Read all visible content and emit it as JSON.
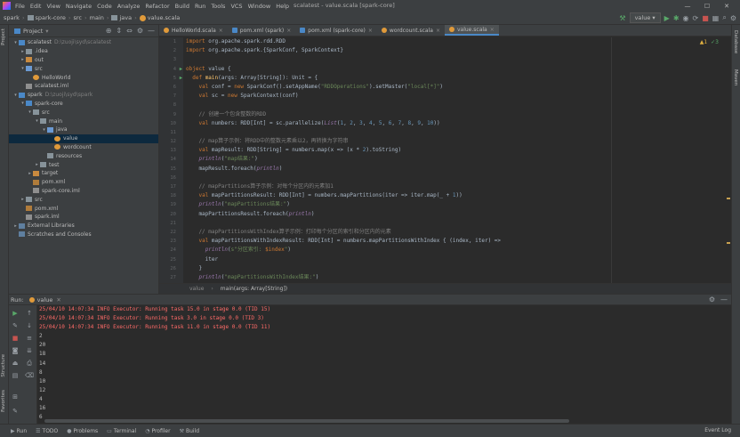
{
  "window": {
    "title": "scalatest - value.scala [spark-core]",
    "menu": [
      "File",
      "Edit",
      "View",
      "Navigate",
      "Code",
      "Analyze",
      "Refactor",
      "Build",
      "Run",
      "Tools",
      "VCS",
      "Window",
      "Help"
    ],
    "controls": [
      "—",
      "☐",
      "✕"
    ]
  },
  "breadcrumb": [
    "spark",
    "spark-core",
    "src",
    "main",
    "java",
    "value.scala"
  ],
  "run_config": "value",
  "left_strip": {
    "project": "Project",
    "structure": "Structure",
    "favorites": "Favorites"
  },
  "right_strip": {
    "database": "Database",
    "maven": "Maven"
  },
  "project": {
    "title": "Project",
    "tree": [
      {
        "label": "scalatest",
        "note": "D:\\zuoji\\syd\\scalatest",
        "arrow": "▾",
        "icon": "t-folder-blue",
        "indent": 0
      },
      {
        "label": ".idea",
        "note": "",
        "arrow": "▸",
        "icon": "t-folder",
        "indent": 1
      },
      {
        "label": "out",
        "note": "",
        "arrow": "▸",
        "icon": "t-folder-orange",
        "indent": 1
      },
      {
        "label": "src",
        "note": "",
        "arrow": "▾",
        "icon": "t-folder-src",
        "indent": 1
      },
      {
        "label": "HelloWorld",
        "note": "",
        "arrow": "",
        "icon": "t-file-scala",
        "indent": 2
      },
      {
        "label": "scalatest.iml",
        "note": "",
        "arrow": "",
        "icon": "t-file-iml",
        "indent": 1
      },
      {
        "label": "spark",
        "note": "D:\\zuoji\\syd\\spark",
        "arrow": "▾",
        "icon": "t-folder-blue",
        "indent": 0
      },
      {
        "label": "spark-core",
        "note": "",
        "arrow": "▾",
        "icon": "t-folder-blue",
        "indent": 1
      },
      {
        "label": "src",
        "note": "",
        "arrow": "▾",
        "icon": "t-folder",
        "indent": 2
      },
      {
        "label": "main",
        "note": "",
        "arrow": "▾",
        "icon": "t-folder",
        "indent": 3
      },
      {
        "label": "java",
        "note": "",
        "arrow": "▾",
        "icon": "t-folder-src",
        "indent": 4
      },
      {
        "label": "value",
        "note": "",
        "arrow": "",
        "icon": "t-file-scala",
        "indent": 5,
        "selected": true
      },
      {
        "label": "wordcount",
        "note": "",
        "arrow": "",
        "icon": "t-file-scala",
        "indent": 5
      },
      {
        "label": "resources",
        "note": "",
        "arrow": "",
        "icon": "t-folder",
        "indent": 4
      },
      {
        "label": "test",
        "note": "",
        "arrow": "▸",
        "icon": "t-folder",
        "indent": 3
      },
      {
        "label": "target",
        "note": "",
        "arrow": "▸",
        "icon": "t-folder-orange",
        "indent": 2
      },
      {
        "label": "pom.xml",
        "note": "",
        "arrow": "",
        "icon": "t-file-xml",
        "indent": 2
      },
      {
        "label": "spark-core.iml",
        "note": "",
        "arrow": "",
        "icon": "t-file-iml",
        "indent": 2
      },
      {
        "label": "src",
        "note": "",
        "arrow": "▸",
        "icon": "t-folder",
        "indent": 1
      },
      {
        "label": "pom.xml",
        "note": "",
        "arrow": "",
        "icon": "t-file-xml",
        "indent": 1
      },
      {
        "label": "spark.iml",
        "note": "",
        "arrow": "",
        "icon": "t-file-iml",
        "indent": 1
      },
      {
        "label": "External Libraries",
        "note": "",
        "arrow": "▸",
        "icon": "t-lib",
        "indent": 0
      },
      {
        "label": "Scratches and Consoles",
        "note": "",
        "arrow": "",
        "icon": "t-lib",
        "indent": 0
      }
    ]
  },
  "tabs": [
    {
      "label": "HelloWorld.scala",
      "kind": "scala",
      "active": false
    },
    {
      "label": "pom.xml (spark)",
      "kind": "maven",
      "active": false
    },
    {
      "label": "pom.xml (spark-core)",
      "kind": "maven",
      "active": false
    },
    {
      "label": "wordcount.scala",
      "kind": "scala",
      "active": false
    },
    {
      "label": "value.scala",
      "kind": "scala",
      "active": true
    }
  ],
  "inspections": {
    "warnings": "▲1",
    "weak": "✓3"
  },
  "code_lines": [
    [
      [
        "kw",
        "import "
      ],
      [
        "",
        "org.apache.spark.rdd.RDD"
      ]
    ],
    [
      [
        "kw",
        "import "
      ],
      [
        "",
        "org.apache.spark.{SparkConf, SparkContext}"
      ]
    ],
    [],
    [
      [
        "kw",
        "object "
      ],
      [
        "",
        "value {"
      ]
    ],
    [
      [
        "",
        "  "
      ],
      [
        "kw",
        "def "
      ],
      [
        "fn",
        "main"
      ],
      [
        "",
        "(args: Array["
      ],
      [
        "ty",
        "String"
      ],
      [
        "",
        "]): "
      ],
      [
        "ty",
        "Unit"
      ],
      [
        "",
        " = {"
      ]
    ],
    [
      [
        "",
        "    "
      ],
      [
        "kw",
        "val "
      ],
      [
        "",
        "conf = "
      ],
      [
        "kw",
        "new "
      ],
      [
        "",
        "SparkConf().setAppName("
      ],
      [
        "str",
        "\"RDDOperations\""
      ],
      [
        "",
        ").setMaster("
      ],
      [
        "str",
        "\"local[*]\""
      ],
      [
        "",
        ")"
      ]
    ],
    [
      [
        "",
        "    "
      ],
      [
        "kw",
        "val "
      ],
      [
        "",
        "sc = "
      ],
      [
        "kw",
        "new "
      ],
      [
        "",
        "SparkContext(conf)"
      ]
    ],
    [],
    [
      [
        "cmt",
        "    // 创建一个包含整数的RDD"
      ]
    ],
    [
      [
        "",
        "    "
      ],
      [
        "kw",
        "val "
      ],
      [
        "",
        "numbers: RDD["
      ],
      [
        "ty",
        "Int"
      ],
      [
        "",
        "] = sc.parallelize("
      ],
      [
        "it",
        "List"
      ],
      [
        "",
        "("
      ],
      [
        "num",
        "1"
      ],
      [
        "",
        ", "
      ],
      [
        "num",
        "2"
      ],
      [
        "",
        ", "
      ],
      [
        "num",
        "3"
      ],
      [
        "",
        ", "
      ],
      [
        "num",
        "4"
      ],
      [
        "",
        ", "
      ],
      [
        "num",
        "5"
      ],
      [
        "",
        ", "
      ],
      [
        "num",
        "6"
      ],
      [
        "",
        ", "
      ],
      [
        "num",
        "7"
      ],
      [
        "",
        ", "
      ],
      [
        "num",
        "8"
      ],
      [
        "",
        ", "
      ],
      [
        "num",
        "9"
      ],
      [
        "",
        ", "
      ],
      [
        "num",
        "10"
      ],
      [
        "",
        "))"
      ]
    ],
    [],
    [
      [
        "cmt",
        "    // map算子示例：将RDD中的整数元素乘以2，再转换为字符串"
      ]
    ],
    [
      [
        "",
        "    "
      ],
      [
        "kw",
        "val "
      ],
      [
        "",
        "mapResult: RDD["
      ],
      [
        "ty",
        "String"
      ],
      [
        "",
        "] = numbers.map(x => (x * "
      ],
      [
        "num",
        "2"
      ],
      [
        "",
        ").toString)"
      ]
    ],
    [
      [
        "",
        "    "
      ],
      [
        "it",
        "println"
      ],
      [
        "",
        "("
      ],
      [
        "str",
        "\"map结果:\""
      ],
      [
        "",
        ")"
      ]
    ],
    [
      [
        "",
        "    mapResult.foreach("
      ],
      [
        "it",
        "println"
      ],
      [
        "",
        ")"
      ]
    ],
    [],
    [
      [
        "cmt",
        "    // mapPartitions算子示例：对每个分区内的元素加1"
      ]
    ],
    [
      [
        "",
        "    "
      ],
      [
        "kw",
        "val "
      ],
      [
        "",
        "mapPartitionsResult: RDD["
      ],
      [
        "ty",
        "Int"
      ],
      [
        "",
        "] = numbers.mapPartitions(iter => iter.map(_ + "
      ],
      [
        "num",
        "1"
      ],
      [
        "",
        "))"
      ]
    ],
    [
      [
        "",
        "    "
      ],
      [
        "it",
        "println"
      ],
      [
        "",
        "("
      ],
      [
        "str",
        "\"mapPartitions结果:\""
      ],
      [
        "",
        ")"
      ]
    ],
    [
      [
        "",
        "    mapPartitionsResult.foreach("
      ],
      [
        "it",
        "println"
      ],
      [
        "",
        ")"
      ]
    ],
    [],
    [
      [
        "cmt",
        "    // mapPartitionsWithIndex算子示例：打印每个分区的索引和分区内的元素"
      ]
    ],
    [
      [
        "",
        "    "
      ],
      [
        "kw",
        "val "
      ],
      [
        "",
        "mapPartitionsWithIndexResult: RDD["
      ],
      [
        "ty",
        "Int"
      ],
      [
        "",
        "] = numbers.mapPartitionsWithIndex { (index, iter) =>"
      ]
    ],
    [
      [
        "",
        "      "
      ],
      [
        "it",
        "println"
      ],
      [
        "",
        "("
      ],
      [
        "str",
        "s\"分区索引: "
      ],
      [
        "kw",
        "$index"
      ],
      [
        "str",
        "\""
      ],
      [
        "",
        ")"
      ]
    ],
    [
      [
        "",
        "      iter"
      ]
    ],
    [
      [
        "",
        "    }"
      ]
    ],
    [
      [
        "",
        "    "
      ],
      [
        "it",
        "println"
      ],
      [
        "",
        "("
      ],
      [
        "str",
        "\"mapPartitionsWithIndex结果:\""
      ],
      [
        "",
        ")"
      ]
    ]
  ],
  "editor_status": {
    "object": "value",
    "method": "main(args: Array[String])"
  },
  "run": {
    "label": "Run:",
    "config": "value",
    "console": [
      {
        "text": "25/04/10 14:07:34 INFO Executor: Running task 15.0 in stage 0.0 (TID 15)",
        "err": true
      },
      {
        "text": "25/04/10 14:07:34 INFO Executor: Running task 3.0 in stage 0.0 (TID 3)",
        "err": true
      },
      {
        "text": "25/04/10 14:07:34 INFO Executor: Running task 11.0 in stage 0.0 (TID 11)",
        "err": true
      },
      {
        "text": "2",
        "err": false
      },
      {
        "text": "20",
        "err": false
      },
      {
        "text": "18",
        "err": false
      },
      {
        "text": "14",
        "err": false
      },
      {
        "text": "8",
        "err": false
      },
      {
        "text": "10",
        "err": false
      },
      {
        "text": "12",
        "err": false
      },
      {
        "text": "4",
        "err": false
      },
      {
        "text": "16",
        "err": false
      },
      {
        "text": "6",
        "err": false
      }
    ]
  },
  "bottom_tabs": [
    {
      "label": "Run",
      "icon": "▶"
    },
    {
      "label": "TODO",
      "icon": "☰"
    },
    {
      "label": "Problems",
      "icon": "●"
    },
    {
      "label": "Terminal",
      "icon": "▭"
    },
    {
      "label": "Profiler",
      "icon": "◔"
    },
    {
      "label": "Build",
      "icon": "⚒"
    }
  ],
  "event_log": "Event Log"
}
